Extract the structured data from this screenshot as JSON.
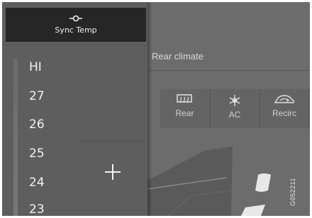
{
  "sync_temp": {
    "label": "Sync Temp",
    "icon": "sync-temp-icon"
  },
  "rear_climate": {
    "label": "Rear climate"
  },
  "climate_buttons": [
    {
      "label": "Rear",
      "icon": "rear-defrost-icon"
    },
    {
      "label": "AC",
      "icon": "ac-snowflake-icon"
    },
    {
      "label": "Recirc",
      "icon": "recirculation-icon"
    }
  ],
  "temperature_list": [
    "HI",
    "27",
    "26",
    "25",
    "24",
    "23"
  ],
  "increase_button": {
    "icon": "plus-icon"
  },
  "diagram_code": "G052211",
  "colors": {
    "background": "#6e6e6e",
    "panel": "#5e5e5e",
    "sync_button": "#262626",
    "text": "#f2f2f2"
  }
}
